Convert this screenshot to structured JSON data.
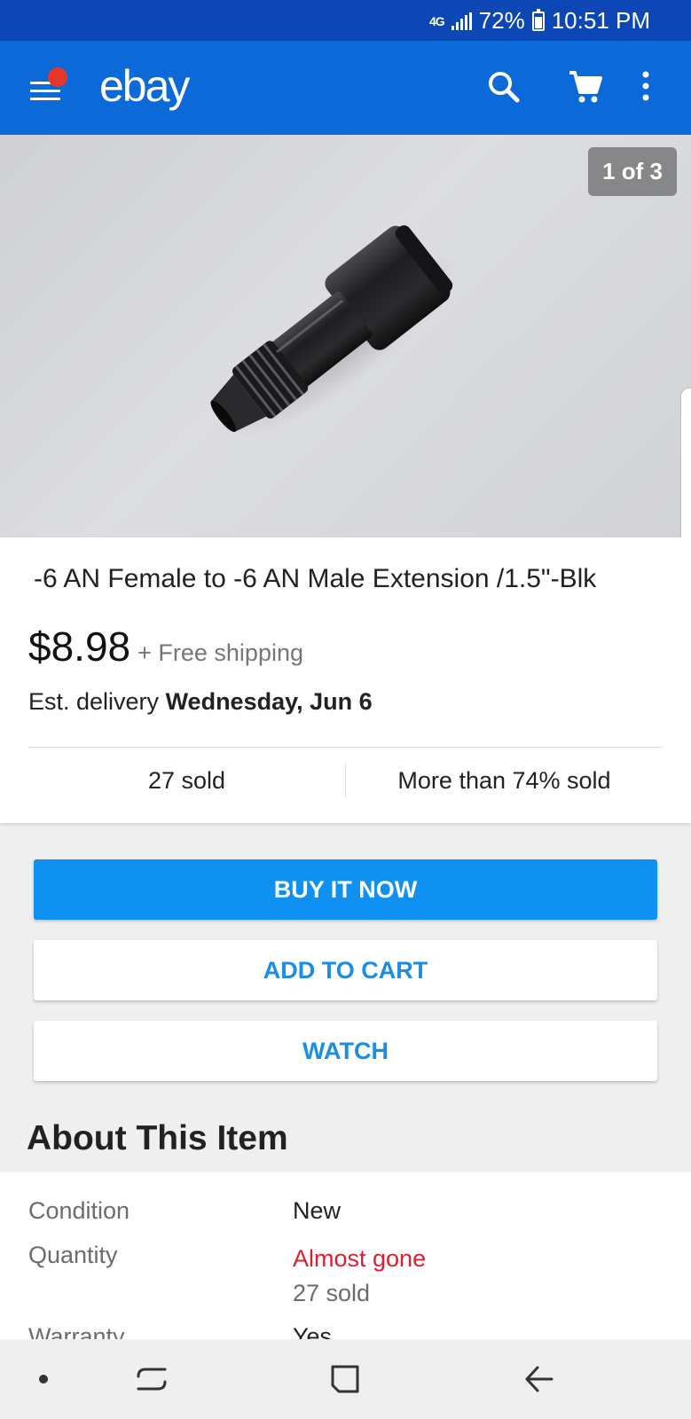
{
  "status_bar": {
    "network": "4G",
    "battery": "72%",
    "time": "10:51 PM"
  },
  "app_bar": {
    "logo": "ebay",
    "menu_icon": "hamburger-menu-icon",
    "search_icon": "search-icon",
    "cart_icon": "cart-icon",
    "more_icon": "more-vertical-icon",
    "notification_color": "#e6352b",
    "background": "#0b6ad8"
  },
  "gallery": {
    "counter": "1 of 3",
    "image_subject": "black AN fitting"
  },
  "product": {
    "title": "-6 AN Female to -6 AN Male Extension /1.5\"-Blk",
    "price": "$8.98",
    "shipping": "+ Free shipping",
    "delivery_prefix": "Est. delivery ",
    "delivery_date": "Wednesday, Jun 6",
    "sold_count": "27 sold",
    "sold_percent": "More than 74% sold"
  },
  "actions": {
    "buy_now": "BUY IT NOW",
    "add_to_cart": "ADD TO CART",
    "watch": "WATCH",
    "primary_color": "#0e91f0"
  },
  "about": {
    "title": "About This Item",
    "rows": [
      {
        "label": "Condition",
        "value": "New"
      },
      {
        "label": "Quantity",
        "value": "Almost gone",
        "value2": "27 sold"
      },
      {
        "label": "Warranty",
        "value": "Yes"
      }
    ]
  },
  "nav_bar": {
    "dot_icon": "dot-icon",
    "recent_icon": "recent-apps-icon",
    "home_icon": "home-icon",
    "back_icon": "back-icon"
  }
}
